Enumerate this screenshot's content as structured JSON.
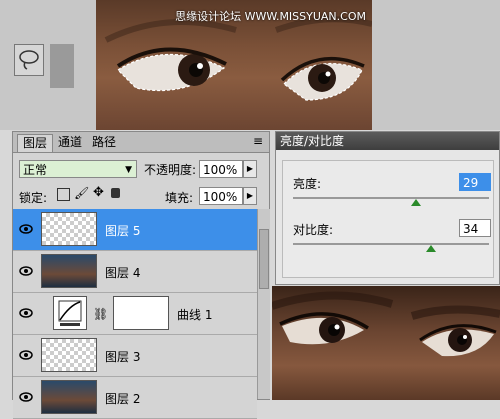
{
  "watermark": "思缘设计论坛 WWW.MISSYUAN.COM",
  "layers_panel": {
    "tabs": [
      "图层",
      "通道",
      "路径"
    ],
    "menu_icon": "≡",
    "blend_mode": "正常",
    "opacity_label": "不透明度:",
    "opacity_value": "100%",
    "lock_label": "锁定:",
    "fill_label": "填充:",
    "fill_value": "100%",
    "layers": [
      {
        "name": "图层 5",
        "selected": true
      },
      {
        "name": "图层 4",
        "selected": false
      },
      {
        "name": "曲线 1",
        "selected": false
      },
      {
        "name": "图层 3",
        "selected": false
      },
      {
        "name": "图层 2",
        "selected": false
      }
    ]
  },
  "bc_dialog": {
    "title": "亮度/对比度",
    "brightness_label": "亮度:",
    "brightness_value": "29",
    "contrast_label": "对比度:",
    "contrast_value": "34"
  },
  "colors": {
    "selection_blue": "#3d8fe9",
    "blend_mode_bg": "#dcf0d4",
    "slider_handle": "#2a8a2a"
  }
}
